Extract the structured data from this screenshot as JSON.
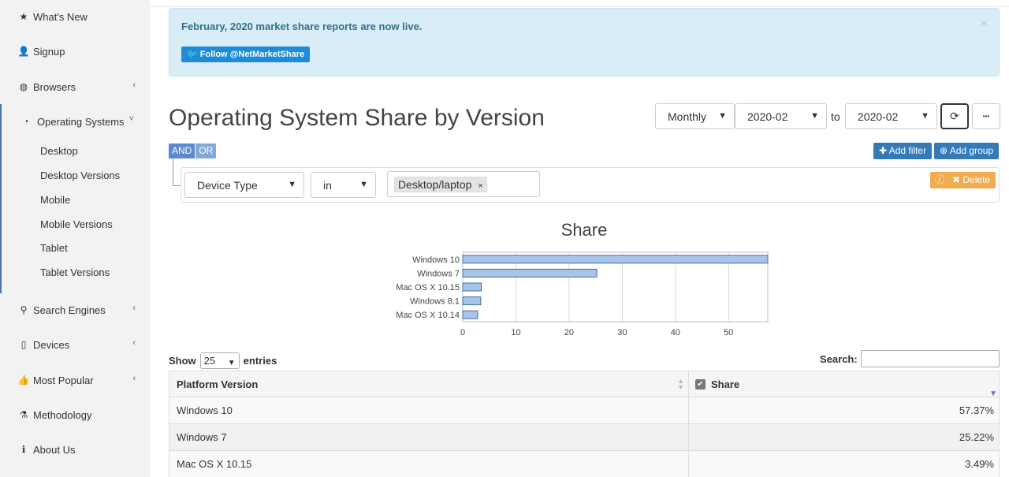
{
  "sidebar": {
    "items": [
      {
        "label": "What's New",
        "icon": "star-icon",
        "glyph": "★"
      },
      {
        "label": "Signup",
        "icon": "user-plus-icon",
        "glyph": "👤"
      },
      {
        "label": "Browsers",
        "icon": "globe-icon",
        "glyph": "◍"
      },
      {
        "label": "Operating Systems",
        "icon": "pie-chart-icon",
        "glyph": "◔"
      },
      {
        "label": "Search Engines",
        "icon": "search-icon",
        "glyph": "⚲"
      },
      {
        "label": "Devices",
        "icon": "tablet-icon",
        "glyph": "▯"
      },
      {
        "label": "Most Popular",
        "icon": "thumbs-up-icon",
        "glyph": "👍"
      },
      {
        "label": "Methodology",
        "icon": "flask-icon",
        "glyph": "⚗"
      },
      {
        "label": "About Us",
        "icon": "info-icon",
        "glyph": "ℹ"
      }
    ],
    "subitems": [
      "Desktop",
      "Desktop Versions",
      "Mobile",
      "Mobile Versions",
      "Tablet",
      "Tablet Versions"
    ],
    "accent": "#4a73b0"
  },
  "alert": {
    "message": "February, 2020 market share reports are now live.",
    "close": "×",
    "twitter_label": "Follow @NetMarketShare"
  },
  "header": {
    "title": "Operating System Share by Version",
    "period": "Monthly",
    "from": "2020-02",
    "to_label": "to",
    "to": "2020-02",
    "refresh_glyph": "⟳",
    "more_glyph": "•••"
  },
  "filter": {
    "and_label": "AND",
    "or_label": "OR",
    "add_filter": "Add filter",
    "add_group": "Add group",
    "field": "Device Type",
    "operator": "in",
    "value": "Desktop/laptop",
    "remove": "×",
    "delete_label": "Delete"
  },
  "chart_data": {
    "type": "bar",
    "orientation": "horizontal",
    "title": "Share",
    "categories": [
      "Windows 10",
      "Windows 7",
      "Mac OS X 10.15",
      "Windows 8.1",
      "Mac OS X 10.14"
    ],
    "values": [
      57.37,
      25.22,
      3.49,
      3.4,
      2.8
    ],
    "xlim": [
      0,
      57.37
    ],
    "xticks": [
      0,
      10,
      20,
      30,
      40,
      50
    ],
    "grid": true,
    "bar_color": "#a7c4e9",
    "bar_border": "#4a6fa5"
  },
  "table": {
    "show_label": "Show",
    "entries_count": "25",
    "entries_label": "entries",
    "search_label": "Search:",
    "columns": [
      "Platform Version",
      "Share"
    ],
    "rows": [
      [
        "Windows 10",
        "57.37%"
      ],
      [
        "Windows 7",
        "25.22%"
      ],
      [
        "Mac OS X 10.15",
        "3.49%"
      ]
    ]
  }
}
